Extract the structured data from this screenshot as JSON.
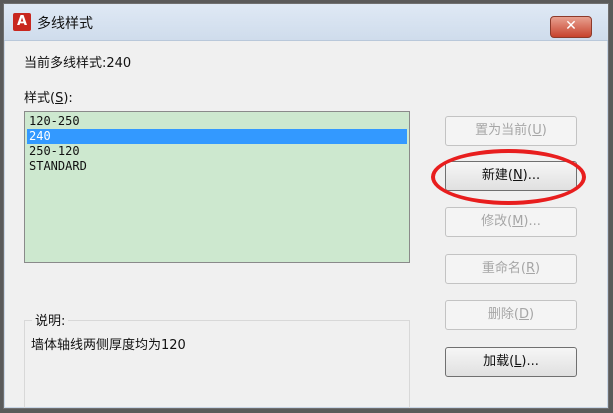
{
  "window": {
    "title": "多线样式",
    "close_symbol": "✕"
  },
  "current_style": "当前多线样式:240",
  "styles_label": {
    "prefix": "样式(",
    "key": "S",
    "suffix": "):"
  },
  "styles": [
    {
      "name": "120-250",
      "selected": false
    },
    {
      "name": "240",
      "selected": true
    },
    {
      "name": "250-120",
      "selected": false
    },
    {
      "name": "STANDARD",
      "selected": false
    }
  ],
  "buttons": {
    "set_current": {
      "prefix": "置为当前(",
      "key": "U",
      "suffix": ")",
      "enabled": false
    },
    "new": {
      "prefix": "新建(",
      "key": "N",
      "suffix": ")...",
      "enabled": true
    },
    "modify": {
      "prefix": "修改(",
      "key": "M",
      "suffix": ")...",
      "enabled": false
    },
    "rename": {
      "prefix": "重命名(",
      "key": "R",
      "suffix": ")",
      "enabled": false
    },
    "delete": {
      "prefix": "删除(",
      "key": "D",
      "suffix": ")",
      "enabled": false
    },
    "load": {
      "prefix": "加载(",
      "key": "L",
      "suffix": ")...",
      "enabled": true
    }
  },
  "description": {
    "label": "说明:",
    "text": "墙体轴线两侧厚度均为120"
  },
  "colors": {
    "list_background": "#cde8cf",
    "selection": "#3399ff",
    "annotation_circle": "#e81e1e"
  },
  "icons": {
    "app": "autocad-logo-icon",
    "close": "close-icon"
  }
}
